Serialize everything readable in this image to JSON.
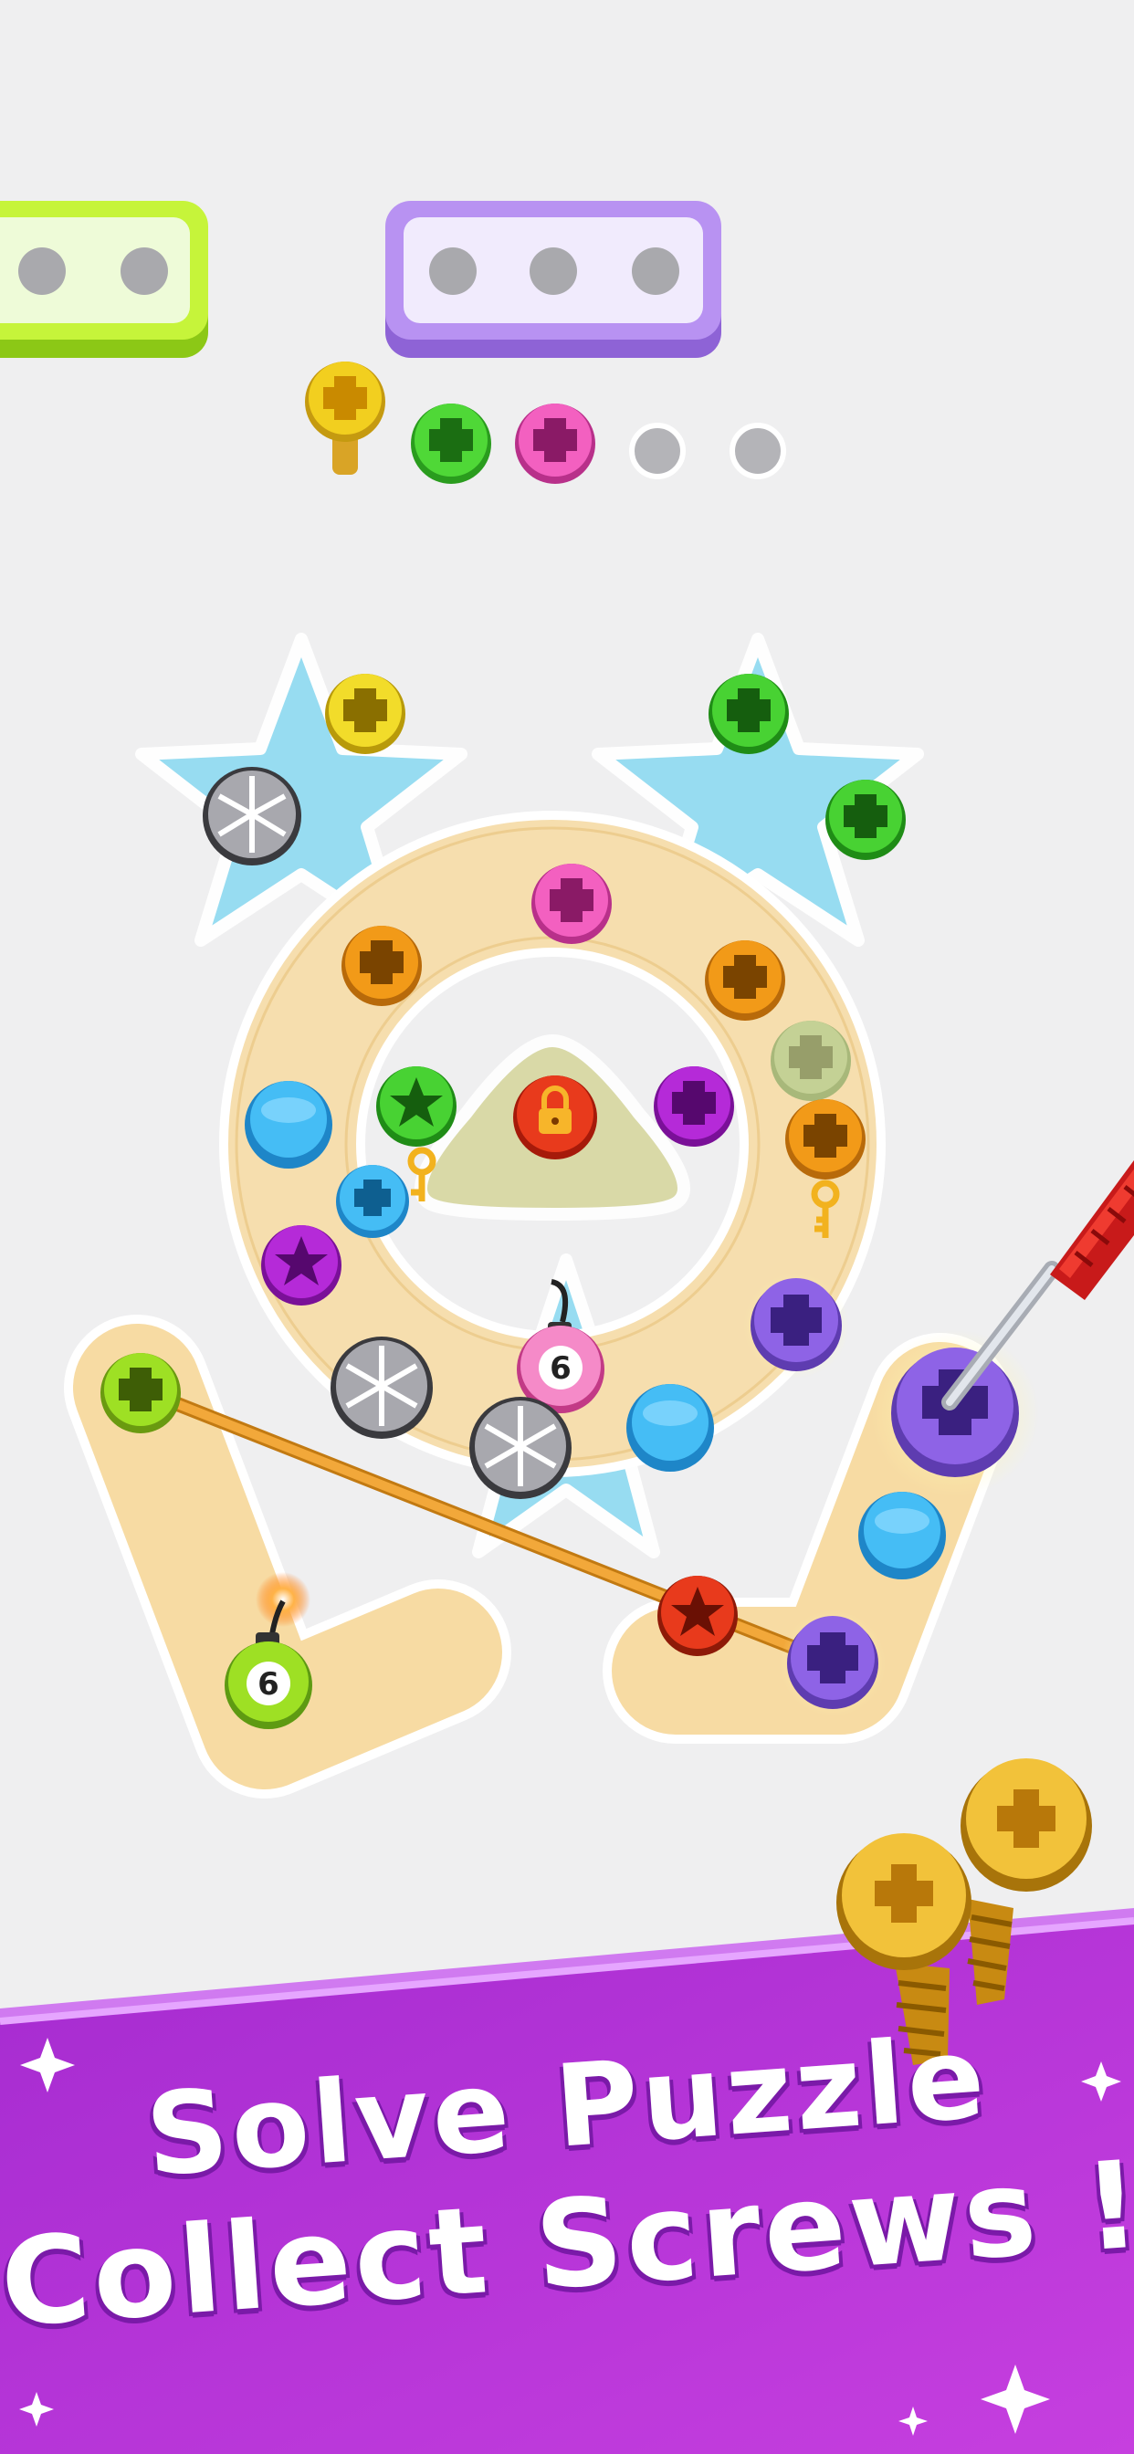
{
  "banner": {
    "line1": "Solve Puzzle",
    "line2": "Collect Screws !"
  },
  "bombs": {
    "left_count": "6",
    "center_count": "6"
  },
  "screw_trays": [
    {
      "color": "lime",
      "slots": 2
    },
    {
      "color": "purple",
      "slots": 3
    }
  ],
  "collected_screws": [
    "yellow",
    "green",
    "pink",
    "empty",
    "empty"
  ],
  "colors": {
    "background": "#efeff0",
    "banner_purple": "#b53ad6",
    "tray_lime": "#b8f02a",
    "tray_purple": "#b98ff0",
    "star_plate": "#8fdcf0",
    "plank": "#f6d79a",
    "screw_yellow": "#f2cf1f",
    "screw_green": "#3fce2a",
    "screw_pink": "#f055b8",
    "screw_orange": "#f29a18",
    "screw_blue": "#3fb4f2",
    "screw_purple": "#8e63e6",
    "screw_red": "#e83a1c",
    "screw_magenta": "#b322d8",
    "screw_gray": "#7a7a80"
  }
}
